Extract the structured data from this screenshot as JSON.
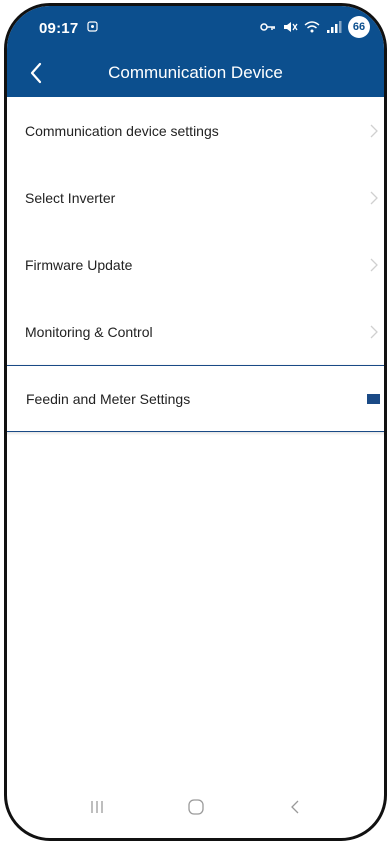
{
  "status_bar": {
    "time": "09:17",
    "battery": "66",
    "icons": [
      "notification-icon",
      "key-icon",
      "mute-icon",
      "wifi-icon",
      "signal-icon"
    ]
  },
  "header": {
    "title": "Communication Device",
    "back_icon": "chevron-left-icon"
  },
  "menu": {
    "items": [
      {
        "label": "Communication device settings"
      },
      {
        "label": "Select Inverter"
      },
      {
        "label": "Firmware Update"
      },
      {
        "label": "Monitoring & Control"
      },
      {
        "label": "Feedin and Meter Settings",
        "selected": true
      }
    ]
  },
  "nav_bar": {
    "icons": [
      "recents-icon",
      "home-icon",
      "back-icon"
    ]
  },
  "colors": {
    "header_bg": "#0c4f8e",
    "selected_border": "#1a4a86",
    "chevron": "#d0d0d0",
    "nav_icon": "#9a9a9a"
  }
}
